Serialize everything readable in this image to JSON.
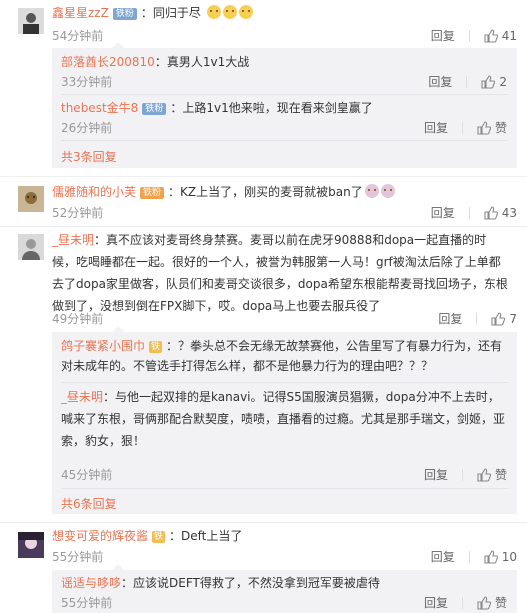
{
  "comments": [
    {
      "user": "鑫星星zzZ",
      "badge": "铁粉",
      "text": "同归于尽",
      "time": "54分钟前",
      "reply": "回复",
      "likes": "41",
      "replies": [
        {
          "user": "部落酋长200810",
          "badge": "",
          "text": "真男人1v1大战",
          "time": "33分钟前",
          "reply": "回复",
          "likes": "2"
        },
        {
          "user": "thebest金牛8",
          "badge": "铁粉",
          "text": "上路1v1他来啦，现在看来剑皇赢了",
          "time": "26分钟前",
          "reply": "回复",
          "likes": "赞"
        }
      ],
      "more": "共3条回复"
    },
    {
      "user": "儒雅随和的小芙",
      "badge": "铁粉",
      "text": "KZ上当了，刚买的麦哥就被ban了",
      "time": "52分钟前",
      "reply": "回复",
      "likes": "43"
    },
    {
      "user": "_昼未明",
      "text": "真不应该对麦哥终身禁赛。麦哥以前在虎牙90888和dopa一起直播的时候，吃喝睡都在一起。很好的一个人，被誉为韩服第一人马！grf被淘汰后除了上单都去了dopa家里做客，队员们和麦哥交谈很多，dopa希望东根能帮麦哥找回场子，东根做到了，没想到倒在FPX脚下，哎。dopa马上也要去服兵役了",
      "time": "49分钟前",
      "reply": "回复",
      "likes": "7",
      "replies": [
        {
          "user": "鸽子褰紧小围巾",
          "badge": "",
          "text": "？拳头总不会无缘无故禁赛他，公告里写了有暴力行为，还有对未成年的。不管选手打得怎么样，都不是他暴力行为的理由吧？？？",
          "time": "",
          "reply": "",
          "likes": ""
        },
        {
          "user": "_昼未明",
          "badge": "",
          "text": "与他一起双排的是kanavi。记得S5国服演员猖獗，dopa分冲不上去时，喊来了东根，哥俩那配合默契度，啧啧，直播看的过瘾。尤其是那手瑞文，剑姬，亚索，豹女，狠！",
          "time": "45分钟前",
          "reply": "回复",
          "likes": "赞"
        }
      ],
      "more": "共6条回复"
    },
    {
      "user": "想变可爱的辉夜酱",
      "badge": "",
      "text": "Deft上当了",
      "time": "55分钟前",
      "reply": "回复",
      "likes": "10",
      "replies": [
        {
          "user": "谣适与哆哆",
          "badge": "",
          "text": "应该说DEFT得救了，不然没拿到冠军要被虐待",
          "time": "55分钟前",
          "reply": "回复",
          "likes": "赞"
        }
      ]
    }
  ]
}
